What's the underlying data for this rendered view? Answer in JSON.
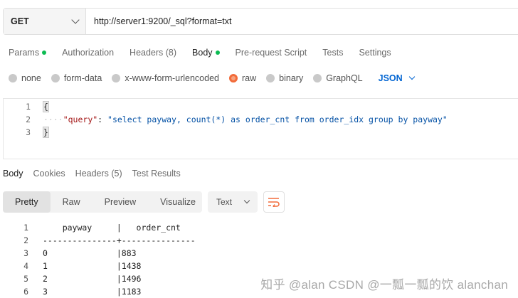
{
  "request": {
    "method": "GET",
    "url": "http://server1:9200/_sql?format=txt"
  },
  "request_tabs": [
    {
      "label": "Params",
      "dot": true
    },
    {
      "label": "Authorization",
      "dot": false
    },
    {
      "label": "Headers (8)",
      "dot": false
    },
    {
      "label": "Body",
      "dot": true,
      "active": true
    },
    {
      "label": "Pre-request Script",
      "dot": false
    },
    {
      "label": "Tests",
      "dot": false
    },
    {
      "label": "Settings",
      "dot": false
    }
  ],
  "body_types": {
    "options": [
      "none",
      "form-data",
      "x-www-form-urlencoded",
      "raw",
      "binary",
      "GraphQL"
    ],
    "selected": "raw",
    "format": "JSON"
  },
  "editor": {
    "lines": [
      {
        "num": "1",
        "text": "{"
      },
      {
        "num": "2",
        "key": "\"query\"",
        "value": "\"select payway, count(*) as order_cnt from order_idx group by payway\""
      },
      {
        "num": "3",
        "text": "}"
      }
    ]
  },
  "response_tabs": [
    "Body",
    "Cookies",
    "Headers (5)",
    "Test Results"
  ],
  "response_views": [
    "Pretty",
    "Raw",
    "Preview",
    "Visualize"
  ],
  "response_format": "Text",
  "output": {
    "lines": [
      {
        "num": "1",
        "text": "    payway     |   order_cnt"
      },
      {
        "num": "2",
        "text": "---------------+---------------"
      },
      {
        "num": "3",
        "text": "0              |883"
      },
      {
        "num": "4",
        "text": "1              |1438"
      },
      {
        "num": "5",
        "text": "2              |1496"
      },
      {
        "num": "6",
        "text": "3              |1183"
      }
    ]
  },
  "watermark": "知乎 @alan  CSDN @一瓢一瓢的饮 alanchan",
  "colors": {
    "status_dot": "#0cbb52",
    "accent_orange": "#f26b3a",
    "json_blue": "#0265d2"
  }
}
